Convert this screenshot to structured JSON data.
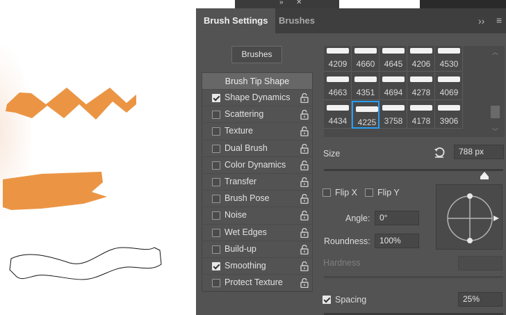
{
  "panel": {
    "tabs": [
      {
        "label": "Brush Settings"
      },
      {
        "label": "Brushes"
      }
    ],
    "menu_icons": [
      "double-chevron-right-icon",
      "hamburger-menu-icon"
    ],
    "brushes_button_label": "Brushes"
  },
  "options": {
    "header": "Brush Tip Shape",
    "items": [
      {
        "label": "Shape Dynamics",
        "checked": true
      },
      {
        "label": "Scattering",
        "checked": false
      },
      {
        "label": "Texture",
        "checked": false
      },
      {
        "label": "Dual Brush",
        "checked": false
      },
      {
        "label": "Color Dynamics",
        "checked": false
      },
      {
        "label": "Transfer",
        "checked": false
      },
      {
        "label": "Brush Pose",
        "checked": false
      },
      {
        "label": "Noise",
        "checked": false
      },
      {
        "label": "Wet Edges",
        "checked": false
      },
      {
        "label": "Build-up",
        "checked": false
      },
      {
        "label": "Smoothing",
        "checked": true
      },
      {
        "label": "Protect Texture",
        "checked": false
      }
    ]
  },
  "presets": {
    "rows": [
      [
        "4209",
        "4660",
        "4645",
        "4206",
        "4530"
      ],
      [
        "4663",
        "4351",
        "4694",
        "4278",
        "4069"
      ],
      [
        "4434",
        "4225",
        "3758",
        "4178",
        "3906"
      ]
    ],
    "selected": "4225"
  },
  "tip": {
    "size_label": "Size",
    "size_value": "788 px",
    "flip_x_label": "Flip X",
    "flip_y_label": "Flip Y",
    "flip_x": false,
    "flip_y": false,
    "angle_label": "Angle:",
    "angle_value": "0°",
    "roundness_label": "Roundness:",
    "roundness_value": "100%",
    "hardness_label": "Hardness",
    "spacing_label": "Spacing",
    "spacing_checked": true,
    "spacing_value": "25%"
  },
  "colors": {
    "stroke_orange": "#ea8f3a",
    "panel_bg": "#535353",
    "selection_blue": "#2a9df4"
  }
}
